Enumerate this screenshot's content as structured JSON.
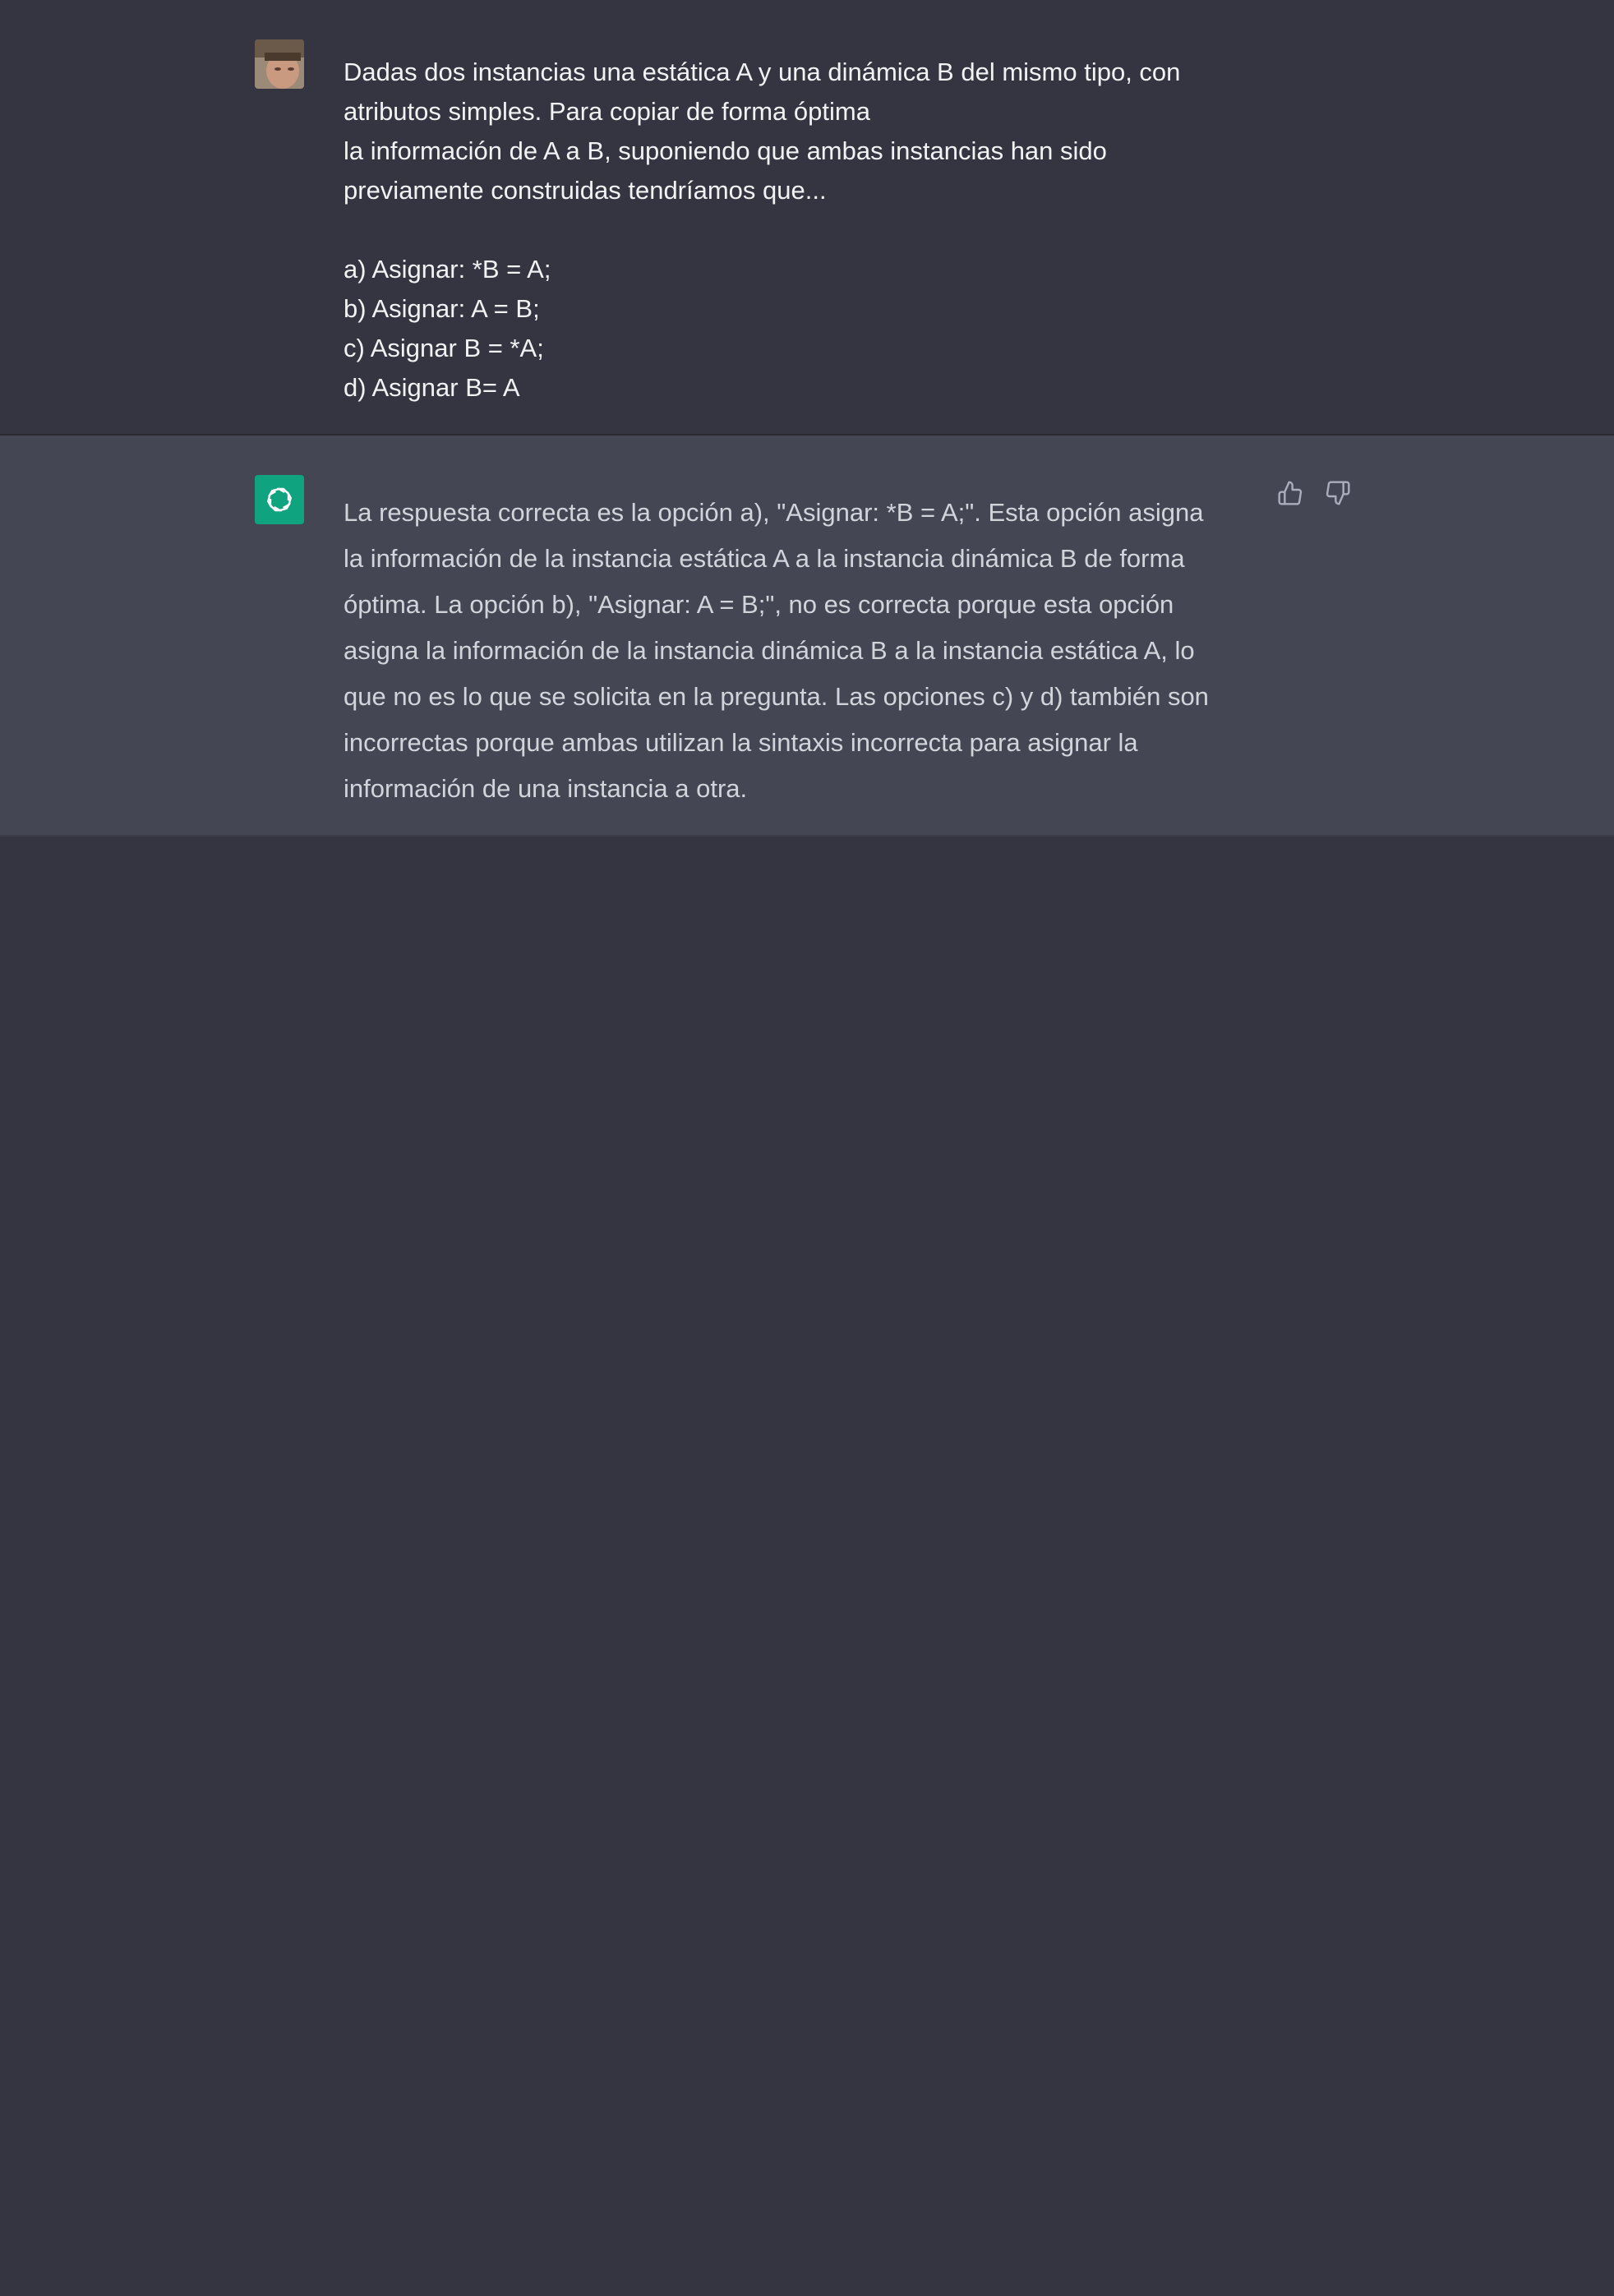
{
  "user_message": {
    "lines": [
      "Dadas dos instancias una estática A y una dinámica B del mismo tipo, con",
      "atributos simples. Para copiar de forma óptima",
      "la información de A a B, suponiendo que ambas instancias han sido",
      "previamente construidas tendríamos que..."
    ],
    "options": [
      "a) Asignar: *B = A;",
      "b) Asignar: A = B;",
      "c) Asignar B = *A;",
      "d) Asignar B= A"
    ]
  },
  "assistant_message": {
    "lines": [
      "La respuesta correcta es la opción a), \"Asignar: *B = A;\". Esta opción asigna",
      "la información de la instancia estática A a la instancia dinámica B de forma",
      "óptima. La opción b), \"Asignar: A = B;\", no es correcta porque esta opción",
      "asigna la información de la instancia dinámica B a la instancia estática A, lo",
      "que no es lo que se solicita en la pregunta. Las opciones c) y d) también son",
      "incorrectas porque ambas utilizan la sintaxis incorrecta para asignar la",
      "información de una instancia a otra."
    ]
  },
  "icons": {
    "assistant_avatar": "openai-logo-icon",
    "thumbs_up": "thumbs-up-icon",
    "thumbs_down": "thumbs-down-icon"
  },
  "colors": {
    "background": "#343541",
    "assistant_background": "#444654",
    "assistant_avatar": "#10a37f"
  }
}
